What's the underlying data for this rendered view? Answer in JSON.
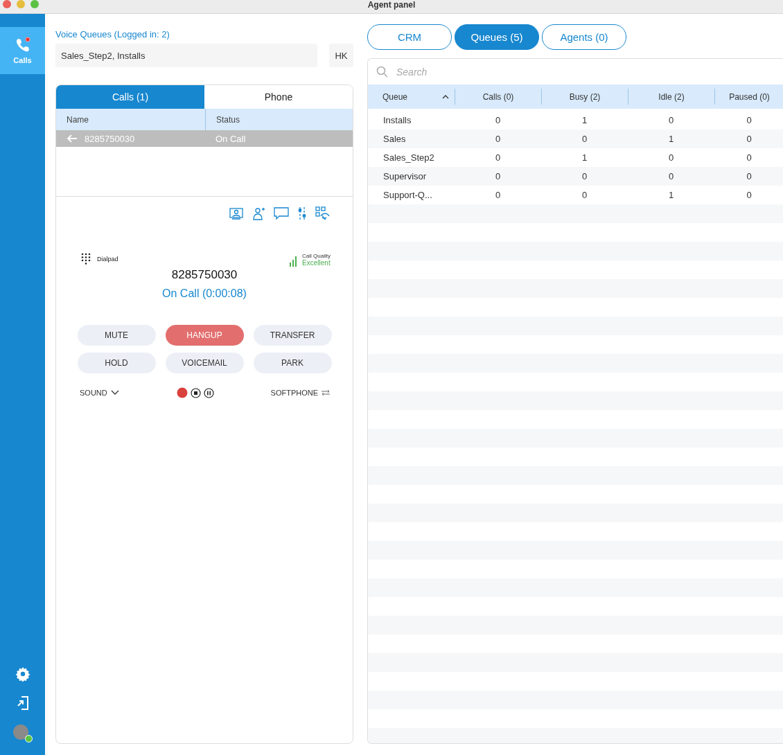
{
  "window": {
    "title": "Agent panel"
  },
  "sidebar": {
    "items": [
      {
        "label": "Calls",
        "selected": true
      }
    ]
  },
  "queues": {
    "label": "Voice Queues (Logged in: 2)",
    "value": "Sales_Step2, Installs",
    "initials": "HK"
  },
  "left_tabs": [
    {
      "label": "Calls (1)",
      "selected": true
    },
    {
      "label": "Phone",
      "selected": false
    }
  ],
  "calls_table": {
    "columns": [
      "Name",
      "Status"
    ],
    "rows": [
      {
        "name": "8285750030",
        "status": "On Call",
        "selected": true
      }
    ]
  },
  "call": {
    "dialpad": "Dialpad",
    "quality_label": "Call Quality",
    "quality": "Excellent",
    "number": "8285750030",
    "status": "On Call (0:00:08)",
    "buttons": [
      {
        "label": "MUTE",
        "kind": "normal"
      },
      {
        "label": "HANGUP",
        "kind": "danger"
      },
      {
        "label": "TRANSFER",
        "kind": "normal"
      },
      {
        "label": "HOLD",
        "kind": "normal"
      },
      {
        "label": "VOICEMAIL",
        "kind": "normal"
      },
      {
        "label": "PARK",
        "kind": "normal"
      }
    ],
    "sound": "SOUND",
    "softphone": "SOFTPHONE"
  },
  "right_tabs": [
    {
      "label": "CRM",
      "selected": false
    },
    {
      "label": "Queues (5)",
      "selected": true
    },
    {
      "label": "Agents (0)",
      "selected": false
    }
  ],
  "search": {
    "placeholder": "Search"
  },
  "queue_table": {
    "columns": [
      "Queue",
      "Calls (0)",
      "Busy (2)",
      "Idle (2)",
      "Paused (0)"
    ],
    "rows": [
      [
        "Installs",
        "0",
        "1",
        "0",
        "0"
      ],
      [
        "Sales",
        "0",
        "0",
        "1",
        "0"
      ],
      [
        "Sales_Step2",
        "0",
        "1",
        "0",
        "0"
      ],
      [
        "Supervisor",
        "0",
        "0",
        "0",
        "0"
      ],
      [
        "Support-Q...",
        "0",
        "0",
        "1",
        "0"
      ]
    ]
  }
}
